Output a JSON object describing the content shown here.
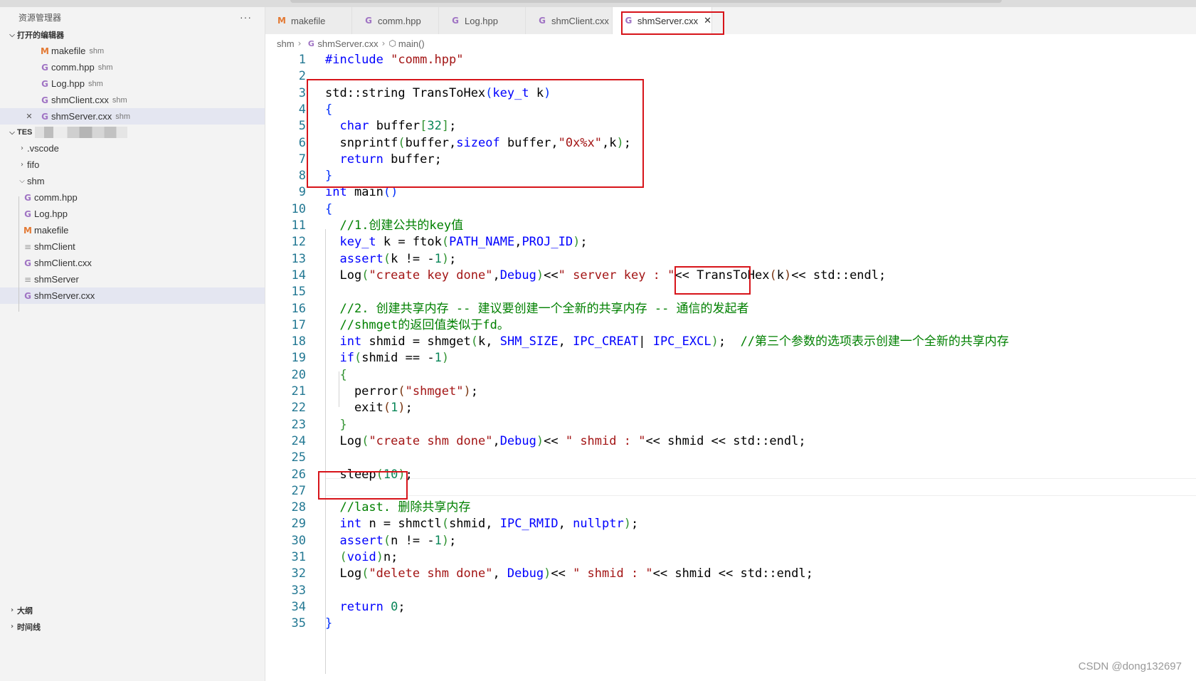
{
  "explorer": {
    "title": "资源管理器",
    "more": "···",
    "open_editors_label": "打开的编辑器",
    "open_editors": [
      {
        "icon": "M",
        "name": "makefile",
        "hint": "shm"
      },
      {
        "icon": "C",
        "name": "comm.hpp",
        "hint": "shm"
      },
      {
        "icon": "C",
        "name": "Log.hpp",
        "hint": "shm"
      },
      {
        "icon": "C",
        "name": "shmClient.cxx",
        "hint": "shm"
      },
      {
        "icon": "C",
        "name": "shmServer.cxx",
        "hint": "shm"
      }
    ],
    "workspace_label": "TES",
    "tree": [
      {
        "name": ".vscode"
      },
      {
        "name": "fifo"
      },
      {
        "name": "shm"
      }
    ],
    "shm_files": [
      "comm.hpp",
      "Log.hpp",
      "makefile",
      "shmClient",
      "shmClient.cxx",
      "shmServer",
      "shmServer.cxx"
    ],
    "outline_label": "大纲",
    "timeline_label": "时间线"
  },
  "tabs": [
    "makefile",
    "comm.hpp",
    "Log.hpp",
    "shmClient.cxx",
    "shmServer.cxx"
  ],
  "breadcrumb": {
    "folder": "shm",
    "file": "shmServer.cxx",
    "symbol": "main()"
  },
  "watermark": "CSDN @dong132697",
  "colors": {
    "highlight_box": "#d7141a",
    "keyword": "#0000ff",
    "string": "#a31515",
    "comment": "#008000",
    "number": "#098658"
  },
  "code_lines": [
    [
      [
        "pp",
        "#include"
      ],
      [
        "st",
        "\"comm.hpp\""
      ]
    ],
    [],
    [
      [
        "",
        "std::string TransToHex"
      ],
      [
        "br1",
        "("
      ],
      [
        "ty",
        "key_t"
      ],
      [
        "",
        "k"
      ],
      [
        "br1",
        ")"
      ]
    ],
    [
      [
        "br1",
        "{"
      ]
    ],
    [
      [
        "",
        "  "
      ],
      [
        "kw",
        "char"
      ],
      [
        "",
        "buffer"
      ],
      [
        "br2",
        "["
      ],
      [
        "nm",
        "32"
      ],
      [
        "br2",
        "]"
      ],
      [
        "",
        ";"
      ]
    ],
    [
      [
        "",
        "  snprintf"
      ],
      [
        "br2",
        "("
      ],
      [
        "",
        "buffer,"
      ],
      [
        "kw",
        "sizeof"
      ],
      [
        "",
        "buffer,"
      ],
      [
        "st",
        "\"0x%x\""
      ],
      [
        "",
        ",k"
      ],
      [
        "br2",
        ")"
      ],
      [
        "",
        ";"
      ]
    ],
    [
      [
        "",
        "  "
      ],
      [
        "kw",
        "return"
      ],
      [
        "",
        "buffer;"
      ]
    ],
    [
      [
        "br1",
        "}"
      ]
    ],
    [
      [
        "kw",
        "int"
      ],
      [
        "",
        "main"
      ],
      [
        "br1",
        "()"
      ]
    ],
    [
      [
        "br1",
        "{"
      ]
    ],
    [
      [
        "",
        "  "
      ],
      [
        "cm",
        "//1.创建公共的key值"
      ]
    ],
    [
      [
        "",
        "  "
      ],
      [
        "ty",
        "key_t"
      ],
      [
        "",
        "k = ftok"
      ],
      [
        "br2",
        "("
      ],
      [
        "mc",
        "PATH_NAME"
      ],
      [
        "",
        ","
      ],
      [
        "mc",
        "PROJ_ID"
      ],
      [
        "br2",
        ")"
      ],
      [
        "",
        ";"
      ]
    ],
    [
      [
        "",
        "  "
      ],
      [
        "kw",
        "assert"
      ],
      [
        "br2",
        "("
      ],
      [
        "",
        "k != -"
      ],
      [
        "nm",
        "1"
      ],
      [
        "br2",
        ")"
      ],
      [
        "",
        ";"
      ]
    ],
    [
      [
        "",
        "  Log"
      ],
      [
        "br2",
        "("
      ],
      [
        "st",
        "\"create key done\""
      ],
      [
        "",
        ","
      ],
      [
        "mc",
        "Debug"
      ],
      [
        "br2",
        ")"
      ],
      [
        "",
        "<<"
      ],
      [
        "st",
        "\" server key : \""
      ],
      [
        "",
        "<< TransToHex"
      ],
      [
        "br3",
        "("
      ],
      [
        "",
        "k"
      ],
      [
        "br3",
        ")"
      ],
      [
        "",
        "<< std::endl;"
      ]
    ],
    [],
    [
      [
        "",
        "  "
      ],
      [
        "cm",
        "//2. 创建共享内存 -- 建议要创建一个全新的共享内存 -- 通信的发起者"
      ]
    ],
    [
      [
        "",
        "  "
      ],
      [
        "cm",
        "//shmget的返回值类似于fd。"
      ]
    ],
    [
      [
        "",
        "  "
      ],
      [
        "kw",
        "int"
      ],
      [
        "",
        "shmid = shmget"
      ],
      [
        "br2",
        "("
      ],
      [
        "",
        "k, "
      ],
      [
        "mc",
        "SHM_SIZE"
      ],
      [
        "",
        ", "
      ],
      [
        "mc",
        "IPC_CREAT"
      ],
      [
        "",
        "| "
      ],
      [
        "mc",
        "IPC_EXCL"
      ],
      [
        "br2",
        ")"
      ],
      [
        "",
        ";  "
      ],
      [
        "cm",
        "//第三个参数的选项表示创建一个全新的共享内存"
      ]
    ],
    [
      [
        "",
        "  "
      ],
      [
        "kw",
        "if"
      ],
      [
        "br2",
        "("
      ],
      [
        "",
        "shmid == -"
      ],
      [
        "nm",
        "1"
      ],
      [
        "br2",
        ")"
      ]
    ],
    [
      [
        "",
        "  "
      ],
      [
        "br2",
        "{"
      ]
    ],
    [
      [
        "",
        "    perror"
      ],
      [
        "br3",
        "("
      ],
      [
        "st",
        "\"shmget\""
      ],
      [
        "br3",
        ")"
      ],
      [
        "",
        ";"
      ]
    ],
    [
      [
        "",
        "    exit"
      ],
      [
        "br3",
        "("
      ],
      [
        "nm",
        "1"
      ],
      [
        "br3",
        ")"
      ],
      [
        "",
        ";"
      ]
    ],
    [
      [
        "",
        "  "
      ],
      [
        "br2",
        "}"
      ]
    ],
    [
      [
        "",
        "  Log"
      ],
      [
        "br2",
        "("
      ],
      [
        "st",
        "\"create shm done\""
      ],
      [
        "",
        ","
      ],
      [
        "mc",
        "Debug"
      ],
      [
        "br2",
        ")"
      ],
      [
        "",
        "<< "
      ],
      [
        "st",
        "\" shmid : \""
      ],
      [
        "",
        "<< shmid << std::endl;"
      ]
    ],
    [],
    [
      [
        "",
        "  sleep"
      ],
      [
        "br2",
        "("
      ],
      [
        "nm",
        "10"
      ],
      [
        "br2",
        ")"
      ],
      [
        "",
        ";"
      ]
    ],
    [],
    [
      [
        "",
        "  "
      ],
      [
        "cm",
        "//last. 删除共享内存"
      ]
    ],
    [
      [
        "",
        "  "
      ],
      [
        "kw",
        "int"
      ],
      [
        "",
        "n = shmctl"
      ],
      [
        "br2",
        "("
      ],
      [
        "",
        "shmid, "
      ],
      [
        "mc",
        "IPC_RMID"
      ],
      [
        "",
        ", "
      ],
      [
        "kw",
        "nullptr"
      ],
      [
        "br2",
        ")"
      ],
      [
        "",
        ";"
      ]
    ],
    [
      [
        "",
        "  "
      ],
      [
        "kw",
        "assert"
      ],
      [
        "br2",
        "("
      ],
      [
        "",
        "n != -"
      ],
      [
        "nm",
        "1"
      ],
      [
        "br2",
        ")"
      ],
      [
        "",
        ";"
      ]
    ],
    [
      [
        "",
        "  "
      ],
      [
        "br2",
        "("
      ],
      [
        "kw",
        "void"
      ],
      [
        "br2",
        ")"
      ],
      [
        "",
        "n;"
      ]
    ],
    [
      [
        "",
        "  Log"
      ],
      [
        "br2",
        "("
      ],
      [
        "st",
        "\"delete shm done\""
      ],
      [
        "",
        ", "
      ],
      [
        "mc",
        "Debug"
      ],
      [
        "br2",
        ")"
      ],
      [
        "",
        "<< "
      ],
      [
        "st",
        "\" shmid : \""
      ],
      [
        "",
        "<< shmid << std::endl;"
      ]
    ],
    [],
    [
      [
        "",
        "  "
      ],
      [
        "kw",
        "return"
      ],
      [
        "nm",
        "0"
      ],
      [
        "",
        ";"
      ]
    ],
    [
      [
        "br1",
        "}"
      ]
    ]
  ]
}
